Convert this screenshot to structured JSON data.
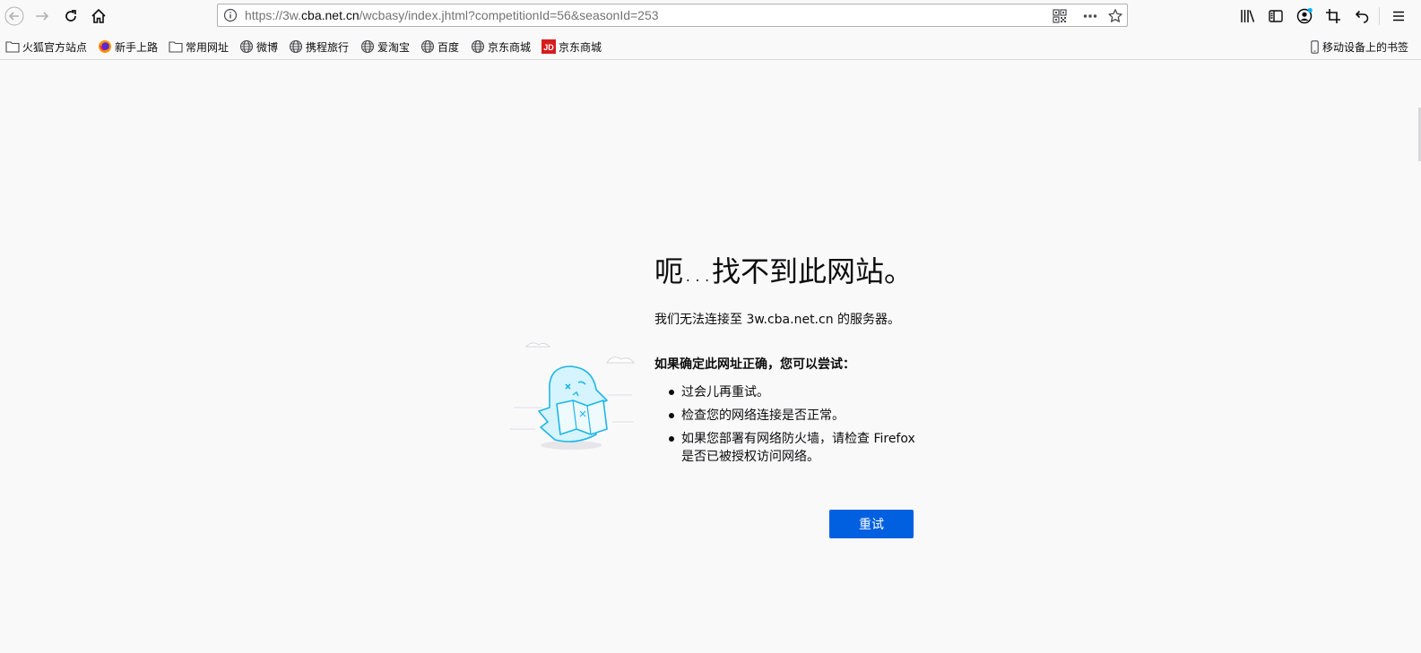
{
  "toolbar": {
    "url_prefix": "https://3w.",
    "url_host": "cba.net.cn",
    "url_path": "/wcbasy/index.jhtml?competitionId=56&seasonId=253"
  },
  "bookmarks": [
    {
      "label": "火狐官方站点",
      "icon": "folder-icon"
    },
    {
      "label": "新手上路",
      "icon": "firefox-icon"
    },
    {
      "label": "常用网址",
      "icon": "folder-icon"
    },
    {
      "label": "微博",
      "icon": "globe-icon"
    },
    {
      "label": "携程旅行",
      "icon": "globe-icon"
    },
    {
      "label": "爱淘宝",
      "icon": "globe-icon"
    },
    {
      "label": "百度",
      "icon": "globe-icon"
    },
    {
      "label": "京东商城",
      "icon": "globe-icon"
    },
    {
      "label": "京东商城",
      "icon": "jd-icon"
    }
  ],
  "mobile_bookmarks": "移动设备上的书签",
  "jd_badge": "JD",
  "error": {
    "title": "呃…找不到此网站。",
    "subtitle": "我们无法连接至 3w.cba.net.cn 的服务器。",
    "suggest_heading": "如果确定此网址正确，您可以尝试：",
    "suggestions": [
      "过会儿再重试。",
      "检查您的网络连接是否正常。",
      "如果您部署有网络防火墙，请检查 Firefox 是否已被授权访问网络。"
    ],
    "retry_label": "重试"
  },
  "colors": {
    "accent": "#0060df",
    "background": "#f9f9fa",
    "notification_dot": "#00b3f4"
  }
}
